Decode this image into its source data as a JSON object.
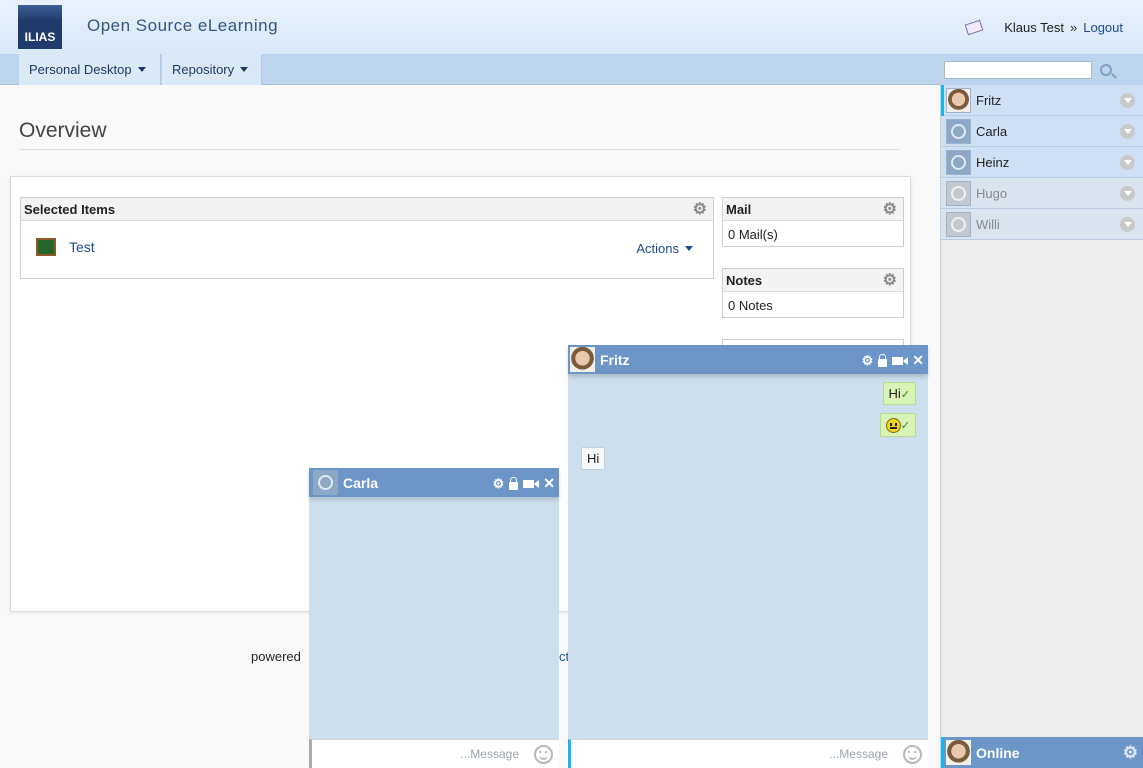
{
  "header": {
    "logo_text": "ILIAS",
    "title": "Open Source eLearning",
    "user_name": "Klaus Test",
    "separator": "»",
    "logout": "Logout"
  },
  "nav": {
    "items": [
      {
        "label": "Personal Desktop"
      },
      {
        "label": "Repository"
      }
    ]
  },
  "main": {
    "page_title": "Overview",
    "selected_items": {
      "title": "Selected Items",
      "item": "Test",
      "actions": "Actions"
    },
    "mail": {
      "title": "Mail",
      "value": "0 Mail(s)"
    },
    "notes": {
      "title": "Notes",
      "value": "0 Notes"
    },
    "footer_powered": "powered",
    "footer_tail": "ct"
  },
  "sidebar": {
    "contacts": [
      {
        "name": "Fritz",
        "status": "online"
      },
      {
        "name": "Carla",
        "status": "online"
      },
      {
        "name": "Heinz",
        "status": "online"
      },
      {
        "name": "Hugo",
        "status": "offline"
      },
      {
        "name": "Willi",
        "status": "offline"
      }
    ],
    "status_label": "Online"
  },
  "chats": {
    "carla": {
      "name": "Carla",
      "placeholder": "...Message"
    },
    "fritz": {
      "name": "Fritz",
      "placeholder": "...Message",
      "messages": [
        {
          "text": "Hi",
          "direction": "out"
        },
        {
          "text": "",
          "direction": "out",
          "emoji": "smiley"
        },
        {
          "text": "Hi",
          "direction": "in"
        }
      ]
    }
  },
  "colors": {
    "accent": "#6b96c7",
    "link": "#1d4b8c",
    "active_marker": "#19b6f0"
  }
}
